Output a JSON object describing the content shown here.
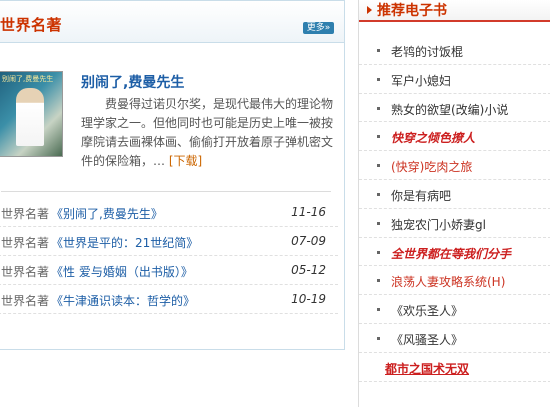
{
  "left": {
    "title": "世界名著",
    "more_label": "更多»",
    "feature": {
      "cover_text": "别闹了,费曼先生",
      "title": "别闹了,费曼先生",
      "description": "费曼得过诺贝尔奖，是现代最伟大的理论物理学家之一。但他同时也可能是历史上唯一被按摩院请去画裸体画、偷偷打开放着原子弹机密文件的保险箱，",
      "ellipsis": "…",
      "download_label": "[下载]"
    },
    "rows": [
      {
        "category": "世界名著",
        "title": "《别闹了,费曼先生》",
        "date": "11-16"
      },
      {
        "category": "世界名著",
        "title": "《世界是平的：21世纪简》",
        "date": "07-09"
      },
      {
        "category": "世界名著",
        "title": "《性 爱与婚姻（出书版）》",
        "date": "05-12"
      },
      {
        "category": "世界名著",
        "title": "《牛津通识读本：哲学的》",
        "date": "10-19"
      }
    ]
  },
  "right": {
    "title": "推荐电子书",
    "items": [
      {
        "label": "老鸨的讨饭棍",
        "style": "normal"
      },
      {
        "label": "军户小媳妇",
        "style": "normal"
      },
      {
        "label": "熟女的欲望(改编)小说",
        "style": "normal"
      },
      {
        "label": "快穿之倾色撩人",
        "style": "red-bold"
      },
      {
        "label": "(快穿)吃肉之旅",
        "style": "red"
      },
      {
        "label": "你是有病吧",
        "style": "normal"
      },
      {
        "label": "独宠农门小娇妻gl",
        "style": "normal"
      },
      {
        "label": "全世界都在等我们分手",
        "style": "red-bold"
      },
      {
        "label": "浪荡人妻攻略系统(H)",
        "style": "red"
      },
      {
        "label": "《欢乐圣人》",
        "style": "normal"
      },
      {
        "label": "《风骚圣人》",
        "style": "normal"
      },
      {
        "label": "都市之国术无双",
        "style": "red-bold-upright"
      }
    ]
  }
}
